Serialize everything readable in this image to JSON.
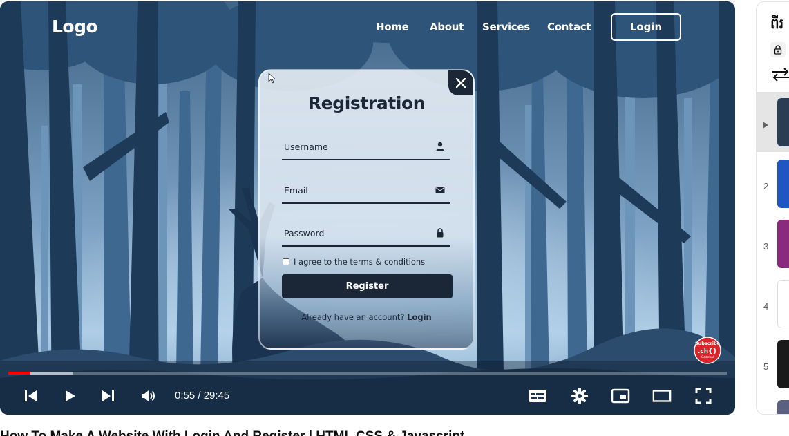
{
  "site": {
    "logo": "Logo",
    "nav": [
      "Home",
      "About",
      "Services",
      "Contact"
    ],
    "login_button": "Login"
  },
  "modal": {
    "title": "Registration",
    "fields": [
      {
        "label": "Username",
        "icon": "user-icon"
      },
      {
        "label": "Email",
        "icon": "envelope-icon"
      },
      {
        "label": "Password",
        "icon": "lock-icon"
      }
    ],
    "checkbox_label": "I agree to the terms & conditions",
    "register_button": "Register",
    "account_text": "Already have an account?",
    "account_link": "Login"
  },
  "subscribe_badge": {
    "top": "Subscribe",
    "bottom": ".ch{}",
    "tag": "Codehal"
  },
  "player": {
    "time_current": "0:55",
    "time_separator": " / ",
    "time_total": "29:45",
    "played_fraction": 0.031,
    "buffered_fraction": 0.09,
    "accent": "#ff0000",
    "controls_left": [
      "previous-icon",
      "play-icon",
      "next-icon",
      "volume-icon"
    ],
    "controls_right": [
      "subtitles-icon",
      "settings-icon",
      "miniplayer-icon",
      "theater-icon",
      "fullscreen-icon"
    ]
  },
  "video_title": "How To Make A Website With Login And Register | HTML CSS & Javascript",
  "playlist": {
    "title": "ពីរ",
    "items": [
      {
        "index": "",
        "color": "#2a3d55",
        "active": true
      },
      {
        "index": "2",
        "color": "#1f56c2"
      },
      {
        "index": "3",
        "color": "#8a2a7e"
      },
      {
        "index": "4",
        "color": "#ffffff"
      },
      {
        "index": "5",
        "color": "#1a1a1a"
      },
      {
        "index": "",
        "color": "#5a6080"
      }
    ]
  }
}
